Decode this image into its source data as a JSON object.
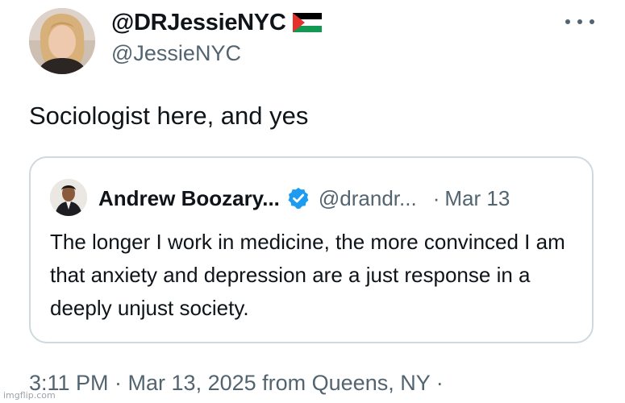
{
  "author": {
    "display_name": "@DRJessieNYC",
    "handle": "@JessieNYC",
    "flag_icon": "palestine-flag-icon",
    "avatar_icon": "profile-photo"
  },
  "tweet": {
    "text": "Sociologist here, and yes",
    "more_icon": "ellipsis-icon"
  },
  "quote": {
    "name": "Andrew Boozary...",
    "handle": "@drandr...",
    "separator": "·",
    "date": "Mar 13",
    "verified_icon": "verified-badge-icon",
    "text": "The longer I work in medicine, the more convinced I am that anxiety and depression are a just response in a deeply unjust society."
  },
  "meta": {
    "timestamp": "3:11 PM · Mar 13, 2025 from Queens, NY ·"
  },
  "watermark": "imgflip.com",
  "colors": {
    "text_primary": "#0f1419",
    "text_secondary": "#536471",
    "border": "#cfd9de",
    "verified": "#1d9bf0"
  }
}
